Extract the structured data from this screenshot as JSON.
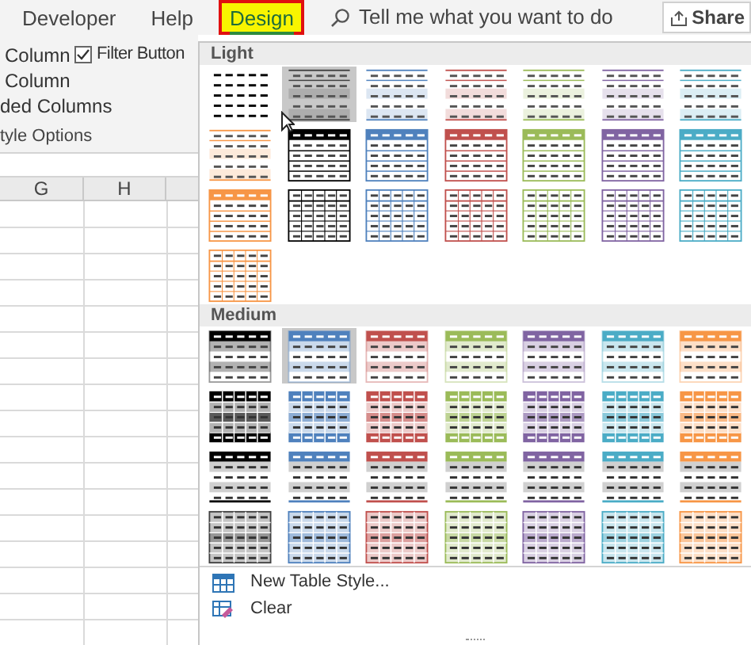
{
  "ribbon_tabs": [
    {
      "label": "Developer",
      "selected": false
    },
    {
      "label": "Help",
      "selected": false
    },
    {
      "label": "Design",
      "selected": true
    }
  ],
  "search": {
    "placeholder": "Tell me what you want to do"
  },
  "share_button": {
    "label": "Share"
  },
  "style_options": [
    {
      "label": "Column",
      "kind": "text"
    },
    {
      "label": "Filter Button",
      "kind": "checkbox",
      "checked": true
    },
    {
      "label": "Column",
      "kind": "text"
    },
    {
      "label": "ded Columns",
      "kind": "text"
    }
  ],
  "group_label": "tyle Options",
  "columns": [
    "G",
    "H"
  ],
  "gallery": {
    "sections": [
      {
        "title": "Light",
        "styles": [
          {
            "kind": "plain",
            "color": "#000000",
            "selected": false
          },
          {
            "kind": "banded",
            "color": "#404040",
            "selected": true
          },
          {
            "kind": "banded",
            "color": "#4f81bd",
            "selected": false
          },
          {
            "kind": "banded",
            "color": "#c0504d",
            "selected": false
          },
          {
            "kind": "banded",
            "color": "#9bbb59",
            "selected": false
          },
          {
            "kind": "banded",
            "color": "#8064a2",
            "selected": false
          },
          {
            "kind": "banded",
            "color": "#4bacc6",
            "selected": false
          },
          {
            "kind": "banded",
            "color": "#f79646",
            "selected": false
          },
          {
            "kind": "header-outline",
            "color": "#000000",
            "selected": false
          },
          {
            "kind": "header-outline",
            "color": "#4f81bd",
            "selected": false
          },
          {
            "kind": "header-outline",
            "color": "#c0504d",
            "selected": false
          },
          {
            "kind": "header-outline",
            "color": "#9bbb59",
            "selected": false
          },
          {
            "kind": "header-outline",
            "color": "#8064a2",
            "selected": false
          },
          {
            "kind": "header-outline",
            "color": "#4bacc6",
            "selected": false
          },
          {
            "kind": "header-outline",
            "color": "#f79646",
            "selected": false
          },
          {
            "kind": "grid",
            "color": "#000000",
            "selected": false
          },
          {
            "kind": "grid",
            "color": "#4f81bd",
            "selected": false
          },
          {
            "kind": "grid",
            "color": "#c0504d",
            "selected": false
          },
          {
            "kind": "grid",
            "color": "#9bbb59",
            "selected": false
          },
          {
            "kind": "grid",
            "color": "#8064a2",
            "selected": false
          },
          {
            "kind": "grid",
            "color": "#4bacc6",
            "selected": false
          },
          {
            "kind": "grid",
            "color": "#f79646",
            "selected": false
          }
        ]
      },
      {
        "title": "Medium",
        "styles": [
          {
            "kind": "header-banded",
            "color": "#000000",
            "selected": false
          },
          {
            "kind": "header-banded",
            "color": "#4f81bd",
            "selected": true
          },
          {
            "kind": "header-banded",
            "color": "#c0504d",
            "selected": false
          },
          {
            "kind": "header-banded",
            "color": "#9bbb59",
            "selected": false
          },
          {
            "kind": "header-banded",
            "color": "#8064a2",
            "selected": false
          },
          {
            "kind": "header-banded",
            "color": "#4bacc6",
            "selected": false
          },
          {
            "kind": "header-banded",
            "color": "#f79646",
            "selected": false
          },
          {
            "kind": "filled-grid",
            "color": "#000000",
            "selected": false
          },
          {
            "kind": "filled-grid",
            "color": "#4f81bd",
            "selected": false
          },
          {
            "kind": "filled-grid",
            "color": "#c0504d",
            "selected": false
          },
          {
            "kind": "filled-grid",
            "color": "#9bbb59",
            "selected": false
          },
          {
            "kind": "filled-grid",
            "color": "#8064a2",
            "selected": false
          },
          {
            "kind": "filled-grid",
            "color": "#4bacc6",
            "selected": false
          },
          {
            "kind": "filled-grid",
            "color": "#f79646",
            "selected": false
          },
          {
            "kind": "header-rules",
            "color": "#000000",
            "selected": false
          },
          {
            "kind": "header-rules",
            "color": "#4f81bd",
            "selected": false
          },
          {
            "kind": "header-rules",
            "color": "#c0504d",
            "selected": false
          },
          {
            "kind": "header-rules",
            "color": "#9bbb59",
            "selected": false
          },
          {
            "kind": "header-rules",
            "color": "#8064a2",
            "selected": false
          },
          {
            "kind": "header-rules",
            "color": "#4bacc6",
            "selected": false
          },
          {
            "kind": "header-rules",
            "color": "#f79646",
            "selected": false
          },
          {
            "kind": "tinted-grid",
            "color": "#404040",
            "selected": false
          },
          {
            "kind": "tinted-grid",
            "color": "#4f81bd",
            "selected": false
          },
          {
            "kind": "tinted-grid",
            "color": "#c0504d",
            "selected": false
          },
          {
            "kind": "tinted-grid",
            "color": "#9bbb59",
            "selected": false
          },
          {
            "kind": "tinted-grid",
            "color": "#8064a2",
            "selected": false
          },
          {
            "kind": "tinted-grid",
            "color": "#4bacc6",
            "selected": false
          },
          {
            "kind": "tinted-grid",
            "color": "#f79646",
            "selected": false
          }
        ]
      }
    ],
    "menu_items": [
      {
        "label": "New Table Style...",
        "kind": "new"
      },
      {
        "label": "Clear",
        "kind": "clear"
      }
    ]
  }
}
